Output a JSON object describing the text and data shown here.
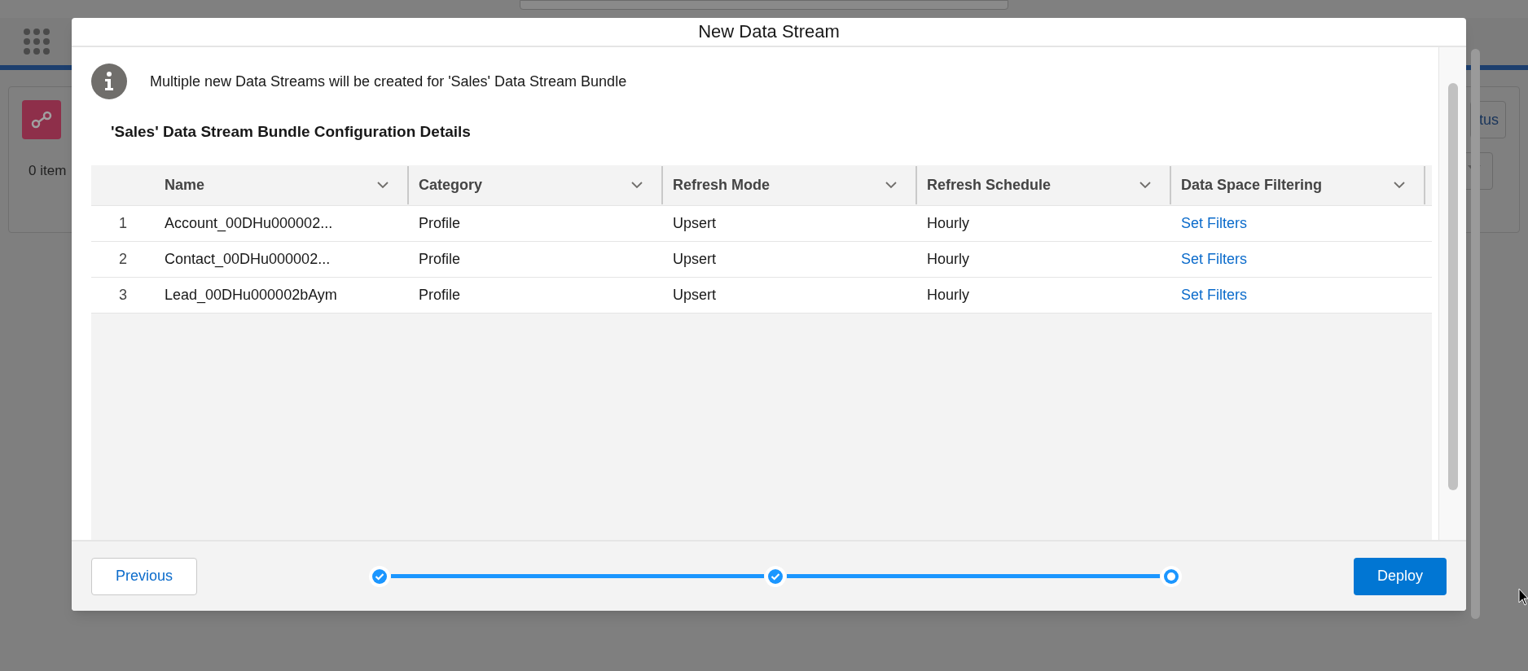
{
  "background": {
    "item_count": "0 item",
    "button_fragment": "tus"
  },
  "modal": {
    "title": "New Data Stream",
    "notice": "Multiple new Data Streams will be created for 'Sales' Data Stream Bundle",
    "section_title": "'Sales' Data Stream Bundle Configuration Details",
    "table": {
      "columns": [
        "Name",
        "Category",
        "Refresh Mode",
        "Refresh Schedule",
        "Data Space Filtering"
      ],
      "rows": [
        {
          "number": "1",
          "name": "Account_00DHu000002...",
          "category": "Profile",
          "refresh_mode": "Upsert",
          "refresh_schedule": "Hourly",
          "filtering": "Set Filters"
        },
        {
          "number": "2",
          "name": "Contact_00DHu000002...",
          "category": "Profile",
          "refresh_mode": "Upsert",
          "refresh_schedule": "Hourly",
          "filtering": "Set Filters"
        },
        {
          "number": "3",
          "name": "Lead_00DHu000002bAym",
          "category": "Profile",
          "refresh_mode": "Upsert",
          "refresh_schedule": "Hourly",
          "filtering": "Set Filters"
        }
      ]
    },
    "footer": {
      "previous": "Previous",
      "deploy": "Deploy",
      "steps": [
        {
          "completed": true
        },
        {
          "completed": true
        },
        {
          "completed": false
        }
      ]
    }
  }
}
